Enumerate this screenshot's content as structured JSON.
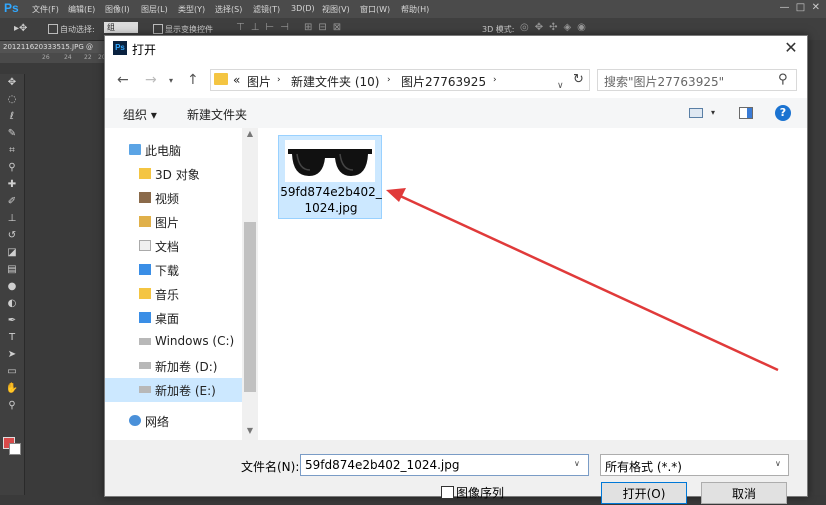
{
  "photoshop": {
    "logo": "Ps",
    "menus": [
      "文件(F)",
      "编辑(E)",
      "图像(I)",
      "图层(L)",
      "类型(Y)",
      "选择(S)",
      "滤镜(T)",
      "3D(D)",
      "视图(V)",
      "窗口(W)",
      "帮助(H)"
    ],
    "options": {
      "auto_select": "自动选择:",
      "auto_select_value": "组",
      "show_transform": "显示变换控件",
      "mode_3d": "3D 模式:"
    },
    "doc_tab": "201211620333515.JPG @",
    "ruler_ticks": [
      "26",
      "24",
      "22",
      "20"
    ],
    "fg_color": "#d84a4a",
    "bg_color": "#ffffff"
  },
  "dialog": {
    "title": "打开",
    "address": {
      "prefix": "«",
      "crumbs": [
        "图片",
        "新建文件夹 (10)",
        "图片27763925"
      ]
    },
    "search_placeholder": "搜索\"图片27763925\"",
    "toolbar": {
      "organize": "组织 ▾",
      "new_folder": "新建文件夹"
    },
    "nav": [
      {
        "label": "此电脑",
        "icon": "computer-icon",
        "sel": false
      },
      {
        "label": "3D 对象",
        "icon": "3d-objects-icon",
        "sel": false
      },
      {
        "label": "视频",
        "icon": "video-folder-icon",
        "sel": false
      },
      {
        "label": "图片",
        "icon": "pictures-folder-icon",
        "sel": false
      },
      {
        "label": "文档",
        "icon": "documents-folder-icon",
        "sel": false
      },
      {
        "label": "下载",
        "icon": "downloads-folder-icon",
        "sel": false
      },
      {
        "label": "音乐",
        "icon": "music-folder-icon",
        "sel": false
      },
      {
        "label": "桌面",
        "icon": "desktop-folder-icon",
        "sel": false
      },
      {
        "label": "Windows (C:)",
        "icon": "windows-drive-icon",
        "sel": false
      },
      {
        "label": "新加卷 (D:)",
        "icon": "drive-icon",
        "sel": false
      },
      {
        "label": "新加卷 (E:)",
        "icon": "drive-icon",
        "sel": true
      },
      {
        "label": "网络",
        "icon": "network-icon",
        "sel": false
      }
    ],
    "file": {
      "name": "59fd874e2b402_1024.jpg"
    },
    "filename_label": "文件名(N):",
    "filename_value": "59fd874e2b402_1024.jpg",
    "filter_value": "所有格式 (*.*)",
    "sequence_label": "图像序列",
    "open_label": "打开(O)",
    "cancel_label": "取消"
  }
}
